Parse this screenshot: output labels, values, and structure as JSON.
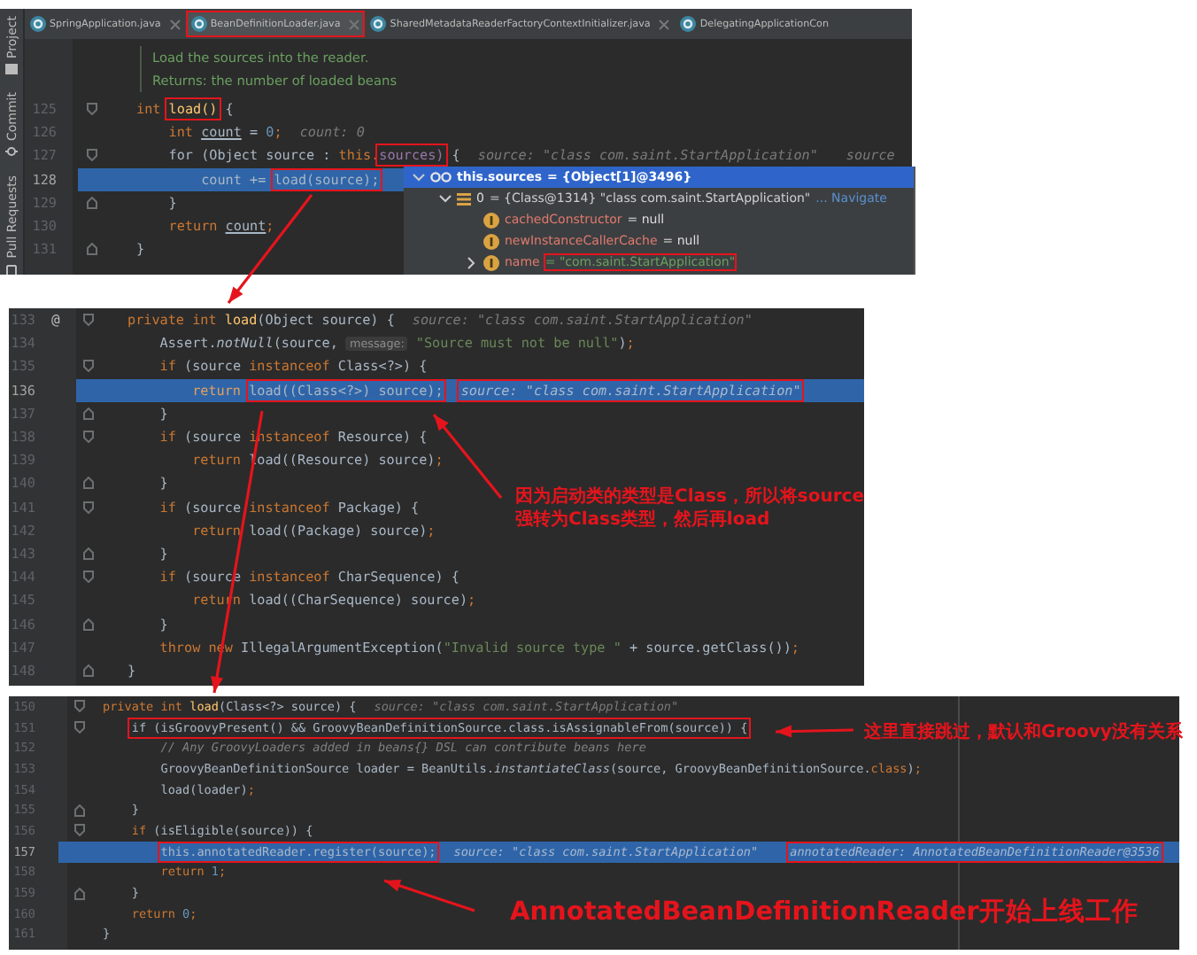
{
  "editors": [
    {
      "tool_strip": [
        {
          "kind": "project",
          "label": "Project"
        },
        {
          "kind": "commit",
          "label": "Commit"
        },
        {
          "kind": "pull-requests",
          "label": "Pull Requests"
        }
      ],
      "tabs": [
        {
          "label": "SpringApplication.java",
          "selected": false,
          "boxed": false,
          "closable": true
        },
        {
          "label": "BeanDefinitionLoader.java",
          "selected": true,
          "boxed": true,
          "closable": true
        },
        {
          "label": "SharedMetadataReaderFactoryContextInitializer.java",
          "selected": false,
          "boxed": false,
          "closable": true
        },
        {
          "label": "DelegatingApplicationCon",
          "selected": false,
          "boxed": false,
          "closable": false
        }
      ],
      "doc_comment": [
        "Load the sources into the reader.",
        "Returns: the number of loaded beans"
      ],
      "lines": [
        {
          "number": "125",
          "current": false,
          "kind": "block-start",
          "tokens": [
            {
              "kind": "kw",
              "text": "int "
            },
            {
              "kind": "fn",
              "text": "load()",
              "boxed": true
            },
            {
              "kind": "plain",
              "text": " {"
            }
          ]
        },
        {
          "number": "126",
          "current": false,
          "kind": "plain",
          "tokens": [
            {
              "kind": "kw",
              "text": "    int "
            },
            {
              "kind": "var",
              "text": "count"
            },
            {
              "kind": "plain",
              "text": " = "
            },
            {
              "kind": "num",
              "text": "0"
            },
            {
              "kind": "kw",
              "text": ";"
            }
          ],
          "hints": [
            {
              "text": "count: 0"
            }
          ]
        },
        {
          "number": "127",
          "current": false,
          "kind": "block-start",
          "tokens": [
            {
              "kind": "plain",
              "text": "    for (Object source : "
            },
            {
              "kind": "kw",
              "text": "this."
            },
            {
              "kind": "field",
              "text": "sources)",
              "boxed": true
            },
            {
              "kind": "plain",
              "text": " {"
            }
          ],
          "hints": [
            {
              "text": "source: \"class com.saint.StartApplication\""
            },
            {
              "text": "source"
            }
          ]
        },
        {
          "number": "128",
          "current": true,
          "kind": "plain",
          "tokens": [
            {
              "kind": "plain",
              "text": "        count += "
            },
            {
              "kind": "plain",
              "text": "load(source);",
              "boxed": true
            }
          ]
        },
        {
          "number": "129",
          "current": false,
          "kind": "block-end",
          "tokens": [
            {
              "kind": "plain",
              "text": "    }"
            }
          ]
        },
        {
          "number": "130",
          "current": false,
          "kind": "plain",
          "tokens": [
            {
              "kind": "kw",
              "text": "    return "
            },
            {
              "kind": "var",
              "text": "count"
            },
            {
              "kind": "kw",
              "text": ";"
            }
          ]
        },
        {
          "number": "131",
          "current": false,
          "kind": "block-end",
          "tokens": [
            {
              "kind": "plain",
              "text": "}"
            }
          ]
        }
      ],
      "debug_tree": [
        {
          "kind": "watch",
          "name": "this.sources",
          "value": "= {Object[1]@3496}",
          "expanded": true,
          "selected": true,
          "children": [
            {
              "kind": "element",
              "name": "0",
              "value": "= {Class@1314} \"class com.saint.StartApplication\"",
              "link": "... Navigate",
              "expanded": true,
              "selected": false,
              "children": [
                {
                  "kind": "field",
                  "name": "cachedConstructor",
                  "value": "= null",
                  "selected": false
                },
                {
                  "kind": "field",
                  "name": "newInstanceCallerCache",
                  "value": "= null",
                  "selected": false
                },
                {
                  "kind": "string-field",
                  "name": "name",
                  "value": "= \"com.saint.StartApplication\"",
                  "expanded": false,
                  "selected": false,
                  "boxed": true
                }
              ]
            }
          ]
        }
      ]
    },
    {
      "lines": [
        {
          "number": "133",
          "current": false,
          "gutter_mark": "@",
          "kind": "block-start",
          "tokens": [
            {
              "kind": "kw",
              "text": "private int "
            },
            {
              "kind": "fn",
              "text": "load"
            },
            {
              "kind": "plain",
              "text": "(Object source) {"
            }
          ],
          "hints": [
            {
              "text": "source: \"class com.saint.StartApplication\""
            }
          ]
        },
        {
          "number": "134",
          "current": false,
          "kind": "plain",
          "tokens": [
            {
              "kind": "plain",
              "text": "    Assert."
            },
            {
              "kind": "static",
              "text": "notNull"
            },
            {
              "kind": "plain",
              "text": "(source, "
            },
            {
              "kind": "param",
              "text": "message:"
            },
            {
              "kind": "str",
              "text": " \"Source must not be null\""
            },
            {
              "kind": "plain",
              "text": ")"
            },
            {
              "kind": "kw",
              "text": ";"
            }
          ]
        },
        {
          "number": "135",
          "current": false,
          "kind": "block-start",
          "tokens": [
            {
              "kind": "kw",
              "text": "    if "
            },
            {
              "kind": "plain",
              "text": "(source "
            },
            {
              "kind": "kw",
              "text": "instanceof "
            },
            {
              "kind": "plain",
              "text": "Class<?>) {"
            }
          ]
        },
        {
          "number": "136",
          "current": true,
          "kind": "plain",
          "tokens": [
            {
              "kind": "kw",
              "text": "        return "
            },
            {
              "kind": "plain",
              "text": "load((Class<?>) source);",
              "boxed": true
            }
          ],
          "hints": [
            {
              "text": "source: \"class com.saint.StartApplication\"",
              "boxed": true
            }
          ]
        },
        {
          "number": "137",
          "current": false,
          "kind": "block-end",
          "tokens": [
            {
              "kind": "plain",
              "text": "    }"
            }
          ]
        },
        {
          "number": "138",
          "current": false,
          "kind": "block-start",
          "tokens": [
            {
              "kind": "kw",
              "text": "    if "
            },
            {
              "kind": "plain",
              "text": "(source "
            },
            {
              "kind": "kw",
              "text": "instanceof "
            },
            {
              "kind": "plain",
              "text": "Resource) {"
            }
          ]
        },
        {
          "number": "139",
          "current": false,
          "kind": "plain",
          "tokens": [
            {
              "kind": "kw",
              "text": "        return "
            },
            {
              "kind": "plain",
              "text": "load((Resource) source)"
            },
            {
              "kind": "kw",
              "text": ";"
            }
          ]
        },
        {
          "number": "140",
          "current": false,
          "kind": "block-end",
          "tokens": [
            {
              "kind": "plain",
              "text": "    }"
            }
          ]
        },
        {
          "number": "141",
          "current": false,
          "kind": "block-start",
          "tokens": [
            {
              "kind": "kw",
              "text": "    if "
            },
            {
              "kind": "plain",
              "text": "(source "
            },
            {
              "kind": "kw",
              "text": "instanceof "
            },
            {
              "kind": "plain",
              "text": "Package) {"
            }
          ]
        },
        {
          "number": "142",
          "current": false,
          "kind": "plain",
          "tokens": [
            {
              "kind": "kw",
              "text": "        return "
            },
            {
              "kind": "plain",
              "text": "load((Package) source)"
            },
            {
              "kind": "kw",
              "text": ";"
            }
          ]
        },
        {
          "number": "143",
          "current": false,
          "kind": "block-end",
          "tokens": [
            {
              "kind": "plain",
              "text": "    }"
            }
          ]
        },
        {
          "number": "144",
          "current": false,
          "kind": "block-start",
          "tokens": [
            {
              "kind": "kw",
              "text": "    if "
            },
            {
              "kind": "plain",
              "text": "(source "
            },
            {
              "kind": "kw",
              "text": "instanceof "
            },
            {
              "kind": "plain",
              "text": "CharSequence) {"
            }
          ]
        },
        {
          "number": "145",
          "current": false,
          "kind": "plain",
          "tokens": [
            {
              "kind": "kw",
              "text": "        return "
            },
            {
              "kind": "plain",
              "text": "load((CharSequence) source)"
            },
            {
              "kind": "kw",
              "text": ";"
            }
          ]
        },
        {
          "number": "146",
          "current": false,
          "kind": "block-end",
          "tokens": [
            {
              "kind": "plain",
              "text": "    }"
            }
          ]
        },
        {
          "number": "147",
          "current": false,
          "kind": "plain",
          "tokens": [
            {
              "kind": "kw",
              "text": "    throw new "
            },
            {
              "kind": "plain",
              "text": "IllegalArgumentException("
            },
            {
              "kind": "str",
              "text": "\"Invalid source type \""
            },
            {
              "kind": "plain",
              "text": " + source.getClass())"
            },
            {
              "kind": "kw",
              "text": ";"
            }
          ]
        },
        {
          "number": "148",
          "current": false,
          "kind": "block-end",
          "tokens": [
            {
              "kind": "plain",
              "text": "}"
            }
          ]
        }
      ]
    },
    {
      "lines": [
        {
          "number": "150",
          "current": false,
          "kind": "block-start",
          "tokens": [
            {
              "kind": "kw",
              "text": "private int "
            },
            {
              "kind": "fn",
              "text": "load"
            },
            {
              "kind": "plain",
              "text": "(Class<?> source) {"
            }
          ],
          "hints": [
            {
              "text": "source: \"class com.saint.StartApplication\""
            }
          ]
        },
        {
          "number": "151",
          "current": false,
          "kind": "block-start",
          "tokens": [
            {
              "kind": "plain",
              "text": "    if (isGroovyPresent() && GroovyBeanDefinitionSource.class.isAssignableFrom(source)) {",
              "boxed": true
            }
          ]
        },
        {
          "number": "152",
          "current": false,
          "kind": "plain",
          "tokens": [
            {
              "kind": "comment",
              "text": "        // Any GroovyLoaders added in beans{} DSL can contribute beans here"
            }
          ]
        },
        {
          "number": "153",
          "current": false,
          "kind": "plain",
          "tokens": [
            {
              "kind": "plain",
              "text": "        GroovyBeanDefinitionSource loader = BeanUtils."
            },
            {
              "kind": "static",
              "text": "instantiateClass"
            },
            {
              "kind": "plain",
              "text": "(source, GroovyBeanDefinitionSource."
            },
            {
              "kind": "kw",
              "text": "class"
            },
            {
              "kind": "plain",
              "text": ")"
            },
            {
              "kind": "kw",
              "text": ";"
            }
          ]
        },
        {
          "number": "154",
          "current": false,
          "kind": "plain",
          "tokens": [
            {
              "kind": "plain",
              "text": "        load(loader)"
            },
            {
              "kind": "kw",
              "text": ";"
            }
          ]
        },
        {
          "number": "155",
          "current": false,
          "kind": "block-end",
          "tokens": [
            {
              "kind": "plain",
              "text": "    }"
            }
          ]
        },
        {
          "number": "156",
          "current": false,
          "kind": "block-start",
          "tokens": [
            {
              "kind": "kw",
              "text": "    if "
            },
            {
              "kind": "plain",
              "text": "(isEligible(source)) {"
            }
          ]
        },
        {
          "number": "157",
          "current": true,
          "kind": "plain",
          "tokens": [
            {
              "kind": "plain",
              "text": "        this.annotatedReader.register(source);",
              "boxed": true
            }
          ],
          "hints": [
            {
              "text": "source: \"class com.saint.StartApplication\""
            },
            {
              "text": "annotatedReader: AnnotatedBeanDefinitionReader@3536",
              "boxed": true
            }
          ]
        },
        {
          "number": "158",
          "current": false,
          "kind": "plain",
          "tokens": [
            {
              "kind": "kw",
              "text": "        return "
            },
            {
              "kind": "num",
              "text": "1"
            },
            {
              "kind": "kw",
              "text": ";"
            }
          ]
        },
        {
          "number": "159",
          "current": false,
          "kind": "block-end",
          "tokens": [
            {
              "kind": "plain",
              "text": "    }"
            }
          ]
        },
        {
          "number": "160",
          "current": false,
          "kind": "plain",
          "tokens": [
            {
              "kind": "kw",
              "text": "    return "
            },
            {
              "kind": "num",
              "text": "0"
            },
            {
              "kind": "kw",
              "text": ";"
            }
          ]
        },
        {
          "number": "161",
          "current": false,
          "kind": "plain",
          "tokens": [
            {
              "kind": "plain",
              "text": "}"
            }
          ]
        }
      ]
    }
  ],
  "annotations": [
    {
      "lines": [
        "因为启动类的类型是Class，所以将source",
        "强转为Class类型，然后再load"
      ]
    },
    {
      "lines": [
        "这里直接跳过，默认和Groovy没有关系"
      ]
    },
    {
      "lines": [
        "AnnotatedBeanDefinitionReader开始上线工作"
      ]
    }
  ]
}
